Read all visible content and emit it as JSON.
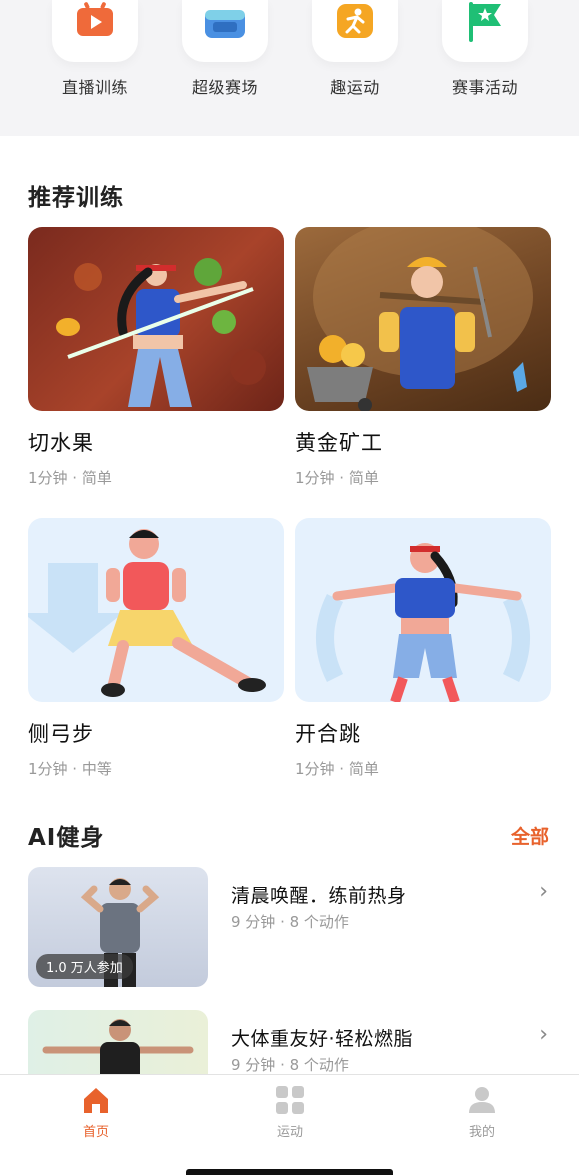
{
  "quick_entries": [
    {
      "label": "直播训练",
      "icon": "tv-play-icon",
      "color": "#ef6a3a"
    },
    {
      "label": "超级赛场",
      "icon": "arena-icon",
      "color": "#4a90e2"
    },
    {
      "label": "趣运动",
      "icon": "running-person-icon",
      "color": "#f5a623"
    },
    {
      "label": "赛事活动",
      "icon": "star-flag-icon",
      "color": "#1fbf75"
    }
  ],
  "recommended": {
    "title": "推荐训练",
    "cards": [
      {
        "title": "切水果",
        "meta": "1分钟 · 简单"
      },
      {
        "title": "黄金矿工",
        "meta": "1分钟 · 简单"
      },
      {
        "title": "侧弓步",
        "meta": "1分钟 · 中等"
      },
      {
        "title": "开合跳",
        "meta": "1分钟 · 简单"
      }
    ]
  },
  "ai_fitness": {
    "title": "AI健身",
    "more_label": "全部",
    "items": [
      {
        "title": "清晨唤醒．练前热身",
        "meta": "9 分钟 · 8 个动作",
        "badge": "1.0 万人参加"
      },
      {
        "title": "大体重友好·轻松燃脂",
        "meta": "9 分钟 · 8 个动作",
        "badge": ""
      }
    ]
  },
  "tabbar": {
    "tabs": [
      {
        "label": "首页",
        "icon": "home-icon",
        "active": true
      },
      {
        "label": "运动",
        "icon": "grid-icon",
        "active": false
      },
      {
        "label": "我的",
        "icon": "user-icon",
        "active": false
      }
    ]
  },
  "colors": {
    "accent": "#e8622c",
    "muted": "#999999"
  }
}
